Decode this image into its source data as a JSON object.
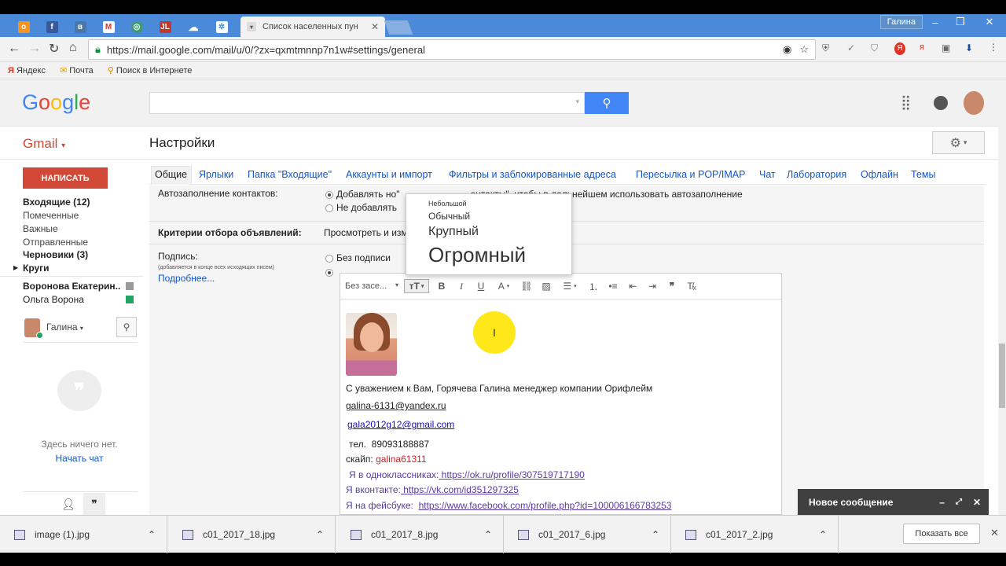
{
  "browser": {
    "user": "Галина",
    "active_tab": "Список населенных пун",
    "url": "https://mail.google.com/mail/u/0/?zx=qxmtmnnp7n1w#settings/general",
    "bookmarks": [
      "Яндекс",
      "Почта",
      "Поиск в Интернете"
    ]
  },
  "gmail": {
    "brand": "Gmail",
    "page_title": "Настройки",
    "compose": "НАПИСАТЬ",
    "nav": {
      "inbox": "Входящие (12)",
      "starred": "Помеченные",
      "important": "Важные",
      "sent": "Отправленные",
      "drafts": "Черновики (3)",
      "circles": "Круги"
    },
    "contacts": [
      "Воронова Екатерин...",
      "Ольга Ворона"
    ],
    "chat": {
      "user": "Галина",
      "empty": "Здесь ничего нет.",
      "start": "Начать чат"
    },
    "tabs": [
      "Общие",
      "Ярлыки",
      "Папка \"Входящие\"",
      "Аккаунты и импорт",
      "Фильтры и заблокированные адреса",
      "Пересылка и POP/IMAP",
      "Чат",
      "Лаборатория",
      "Офлайн",
      "Темы"
    ],
    "settings": {
      "autocomplete_label": "Автозаполнение контактов:",
      "autocomplete_opt1_a": "Добавлять но",
      "autocomplete_opt1_b": "\"                           онтакты\", чтобы в дальнейшем использовать автозаполнение",
      "autocomplete_opt2": "Не добавлять",
      "criteria_label": "Критерии отбора объявлений:",
      "criteria_value": "Просмотреть и изм",
      "signature_label": "Подпись:",
      "signature_hint": "(добавляется в конце всех исходящих писем)",
      "more": "Подробнее...",
      "no_signature": "Без подписи"
    },
    "editor": {
      "font": "Без засе...",
      "greeting": "С уважением к Вам, Горячева Галина менеджер компании Орифлейм",
      "email1": "galina-6131@yandex.ru",
      "email2": "gala2012g12@gmail.com",
      "phone_label": "тел.",
      "phone": "89093188887",
      "skype_label": "скайп:",
      "skype": "galina61311",
      "ok_label": "Я в одноклассниках:",
      "ok_link": " https://ok.ru/profile/307519717190",
      "vk_label": "Я вконтакте:",
      "vk_link": " https://vk.com/id351297325 ",
      "fb_label": "Я на фейсбуке:",
      "fb_link": "https://www.facebook.com/profile.php?id=100006166783253"
    },
    "font_menu": [
      "Небольшой",
      "Обычный",
      "Крупный",
      "Огромный"
    ],
    "compose_bar": "Новое сообщение"
  },
  "downloads": [
    "image (1).jpg",
    "c01_2017_18.jpg",
    "c01_2017_8.jpg",
    "c01_2017_6.jpg",
    "c01_2017_2.jpg"
  ],
  "show_all": "Показать все"
}
